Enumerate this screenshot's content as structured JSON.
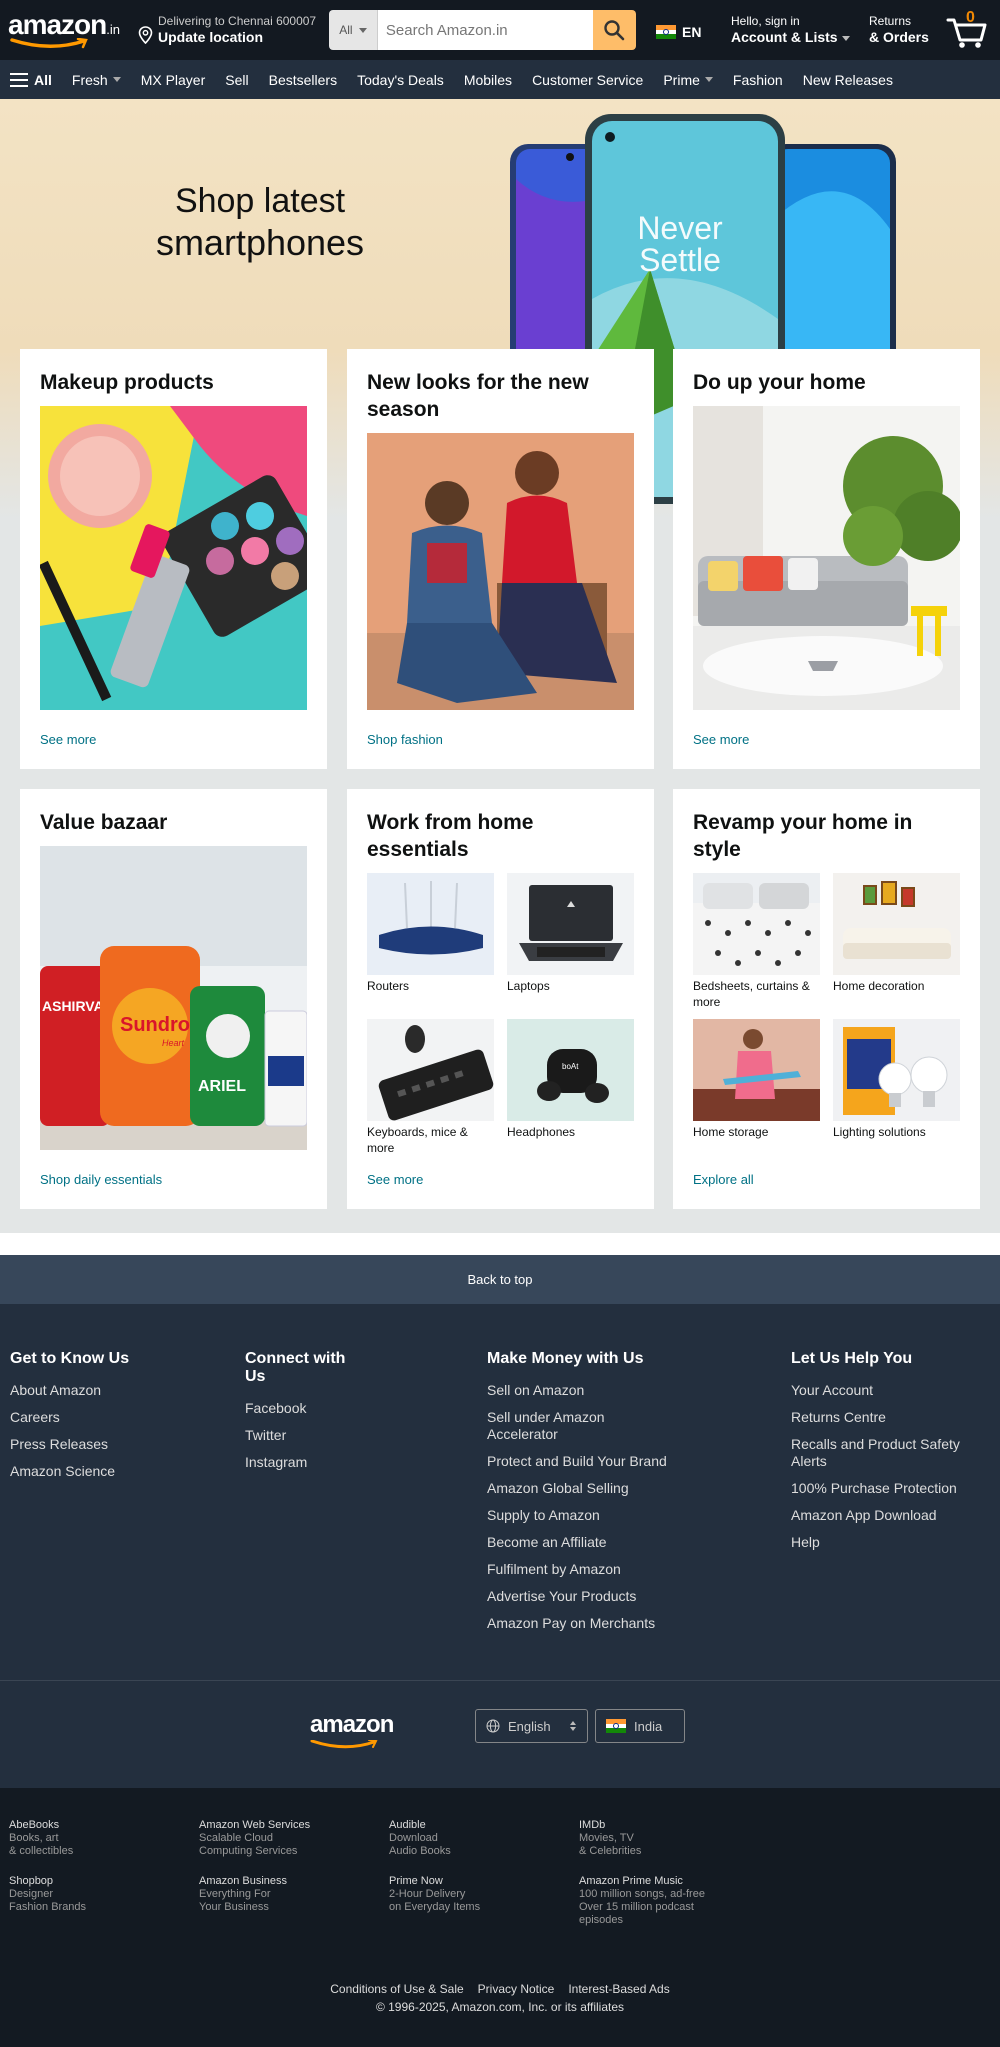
{
  "header": {
    "logo_text": "amazon",
    "logo_suffix": ".in",
    "delivery_line1": "Delivering to Chennai 600007",
    "delivery_line2": "Update location",
    "search_category": "All",
    "search_placeholder": "Search Amazon.in",
    "language": "EN",
    "account_line1": "Hello, sign in",
    "account_line2": "Account & Lists",
    "returns_line1": "Returns",
    "returns_line2": "& Orders",
    "cart_count": "0"
  },
  "nav": {
    "all_label": "All",
    "items": [
      "Fresh",
      "MX Player",
      "Sell",
      "Bestsellers",
      "Today's Deals",
      "Mobiles",
      "Customer Service",
      "Prime",
      "Fashion",
      "New Releases"
    ]
  },
  "hero": {
    "line1": "Shop latest",
    "line2": "smartphones",
    "phone_text_line1": "Never",
    "phone_text_line2": "Settle"
  },
  "cards": [
    {
      "title": "Makeup products",
      "link": "See more"
    },
    {
      "title": "New looks for the new season",
      "link": "Shop fashion"
    },
    {
      "title": "Do up your home",
      "link": "See more"
    },
    {
      "title": "Value bazaar",
      "link": "Shop daily essentials"
    },
    {
      "title": "Work from home essentials",
      "link": "See more",
      "items": [
        "Routers",
        "Laptops",
        "Keyboards, mice & more",
        "Headphones"
      ]
    },
    {
      "title": "Revamp your home in style",
      "link": "Explore all",
      "items": [
        "Bedsheets, curtains & more",
        "Home decoration",
        "Home storage",
        "Lighting solutions"
      ]
    }
  ],
  "value_bazaar_brands": [
    "ASHIRVAAD",
    "Sundrop",
    "Heart",
    "ARIEL"
  ],
  "footer": {
    "back_to_top": "Back to top",
    "columns": [
      {
        "title": "Get to Know Us",
        "links": [
          "About Amazon",
          "Careers",
          "Press Releases",
          "Amazon Science"
        ]
      },
      {
        "title": "Connect with Us",
        "links": [
          "Facebook",
          "Twitter",
          "Instagram"
        ]
      },
      {
        "title": "Make Money with Us",
        "links": [
          "Sell on Amazon",
          "Sell under Amazon Accelerator",
          "Protect and Build Your Brand",
          "Amazon Global Selling",
          "Supply to Amazon",
          "Become an Affiliate",
          "Fulfilment by Amazon",
          "Advertise Your Products",
          "Amazon Pay on Merchants"
        ]
      },
      {
        "title": "Let Us Help You",
        "links": [
          "Your Account",
          "Returns Centre",
          "Recalls and Product Safety Alerts",
          "100% Purchase Protection",
          "Amazon App Download",
          "Help"
        ]
      }
    ],
    "logo_text": "amazon",
    "language_select": "English",
    "country_select": "India",
    "services": [
      {
        "title": "AbeBooks",
        "desc": [
          "Books, art",
          "& collectibles"
        ]
      },
      {
        "title": "Amazon Web Services",
        "desc": [
          "Scalable Cloud",
          "Computing Services"
        ]
      },
      {
        "title": "Audible",
        "desc": [
          "Download",
          "Audio Books"
        ]
      },
      {
        "title": "IMDb",
        "desc": [
          "Movies, TV",
          "& Celebrities"
        ]
      },
      {
        "title": "Shopbop",
        "desc": [
          "Designer",
          "Fashion Brands"
        ]
      },
      {
        "title": "Amazon Business",
        "desc": [
          "Everything For",
          "Your Business"
        ]
      },
      {
        "title": "Prime Now",
        "desc": [
          "2-Hour Delivery",
          "on Everyday Items"
        ]
      },
      {
        "title": "Amazon Prime Music",
        "desc": [
          "100 million songs, ad-free",
          "Over 15 million podcast episodes"
        ]
      }
    ],
    "legal_links": [
      "Conditions of Use & Sale",
      "Privacy Notice",
      "Interest-Based Ads"
    ],
    "copyright": "© 1996-2025, Amazon.com, Inc. or its affiliates"
  },
  "colors": {
    "header_bg": "#131921",
    "nav_bg": "#232f3e",
    "search_button": "#febd69",
    "cart_count": "#f08804",
    "link": "#007185",
    "back_to_top_bg": "#37475a",
    "footer_bottom_bg": "#131a22"
  }
}
